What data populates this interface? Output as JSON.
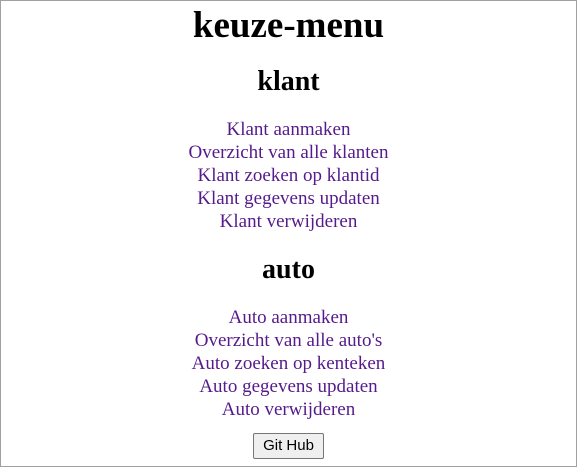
{
  "page": {
    "title": "keuze-menu"
  },
  "sections": {
    "klant": {
      "title": "klant",
      "links": [
        "Klant aanmaken",
        "Overzicht van alle klanten",
        "Klant zoeken op klantid",
        "Klant gegevens updaten",
        "Klant verwijderen"
      ]
    },
    "auto": {
      "title": "auto",
      "links": [
        "Auto aanmaken",
        "Overzicht van alle auto's",
        "Auto zoeken op kenteken",
        "Auto gegevens updaten",
        "Auto verwijderen"
      ]
    }
  },
  "footer": {
    "github_label": "Git Hub"
  },
  "colors": {
    "link": "#551a8b",
    "text": "#000000",
    "background": "#ffffff"
  }
}
